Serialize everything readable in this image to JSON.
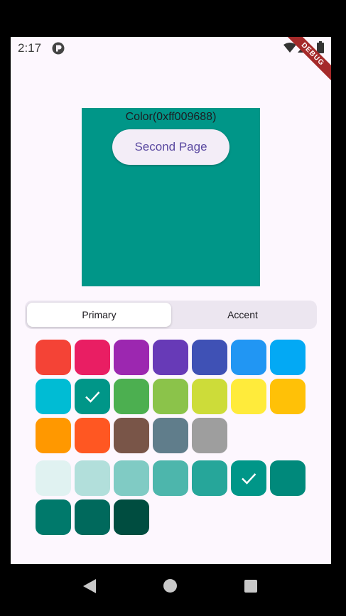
{
  "status_bar": {
    "time": "2:17",
    "icons": [
      "notification-p-icon",
      "wifi-icon",
      "signal-icon",
      "battery-icon"
    ]
  },
  "debug_banner": "DEBUG",
  "preview": {
    "color_hex": "#009688",
    "label": "Color(0xff009688)",
    "button_label": "Second Page"
  },
  "tabs": {
    "selected": "Primary",
    "primary_label": "Primary",
    "accent_label": "Accent"
  },
  "main_colors": [
    {
      "color": "#f44336"
    },
    {
      "color": "#e91e63"
    },
    {
      "color": "#9c27b0"
    },
    {
      "color": "#673ab7"
    },
    {
      "color": "#3f51b5"
    },
    {
      "color": "#2196f3"
    },
    {
      "color": "#03a9f4"
    },
    {
      "color": "#00bcd4"
    },
    {
      "color": "#009688",
      "selected": true
    },
    {
      "color": "#4caf50"
    },
    {
      "color": "#8bc34a"
    },
    {
      "color": "#cddc39"
    },
    {
      "color": "#ffeb3b"
    },
    {
      "color": "#ffc107"
    },
    {
      "color": "#ff9800"
    },
    {
      "color": "#ff5722"
    },
    {
      "color": "#795548"
    },
    {
      "color": "#607d8b"
    },
    {
      "color": "#9e9e9e"
    }
  ],
  "shade_colors": [
    {
      "color": "#e0f2f1"
    },
    {
      "color": "#b2dfdb"
    },
    {
      "color": "#80cbc4"
    },
    {
      "color": "#4db6ac"
    },
    {
      "color": "#26a69a"
    },
    {
      "color": "#009688",
      "selected": true
    },
    {
      "color": "#00897b"
    },
    {
      "color": "#00796b"
    },
    {
      "color": "#00695c"
    },
    {
      "color": "#004d40"
    }
  ]
}
